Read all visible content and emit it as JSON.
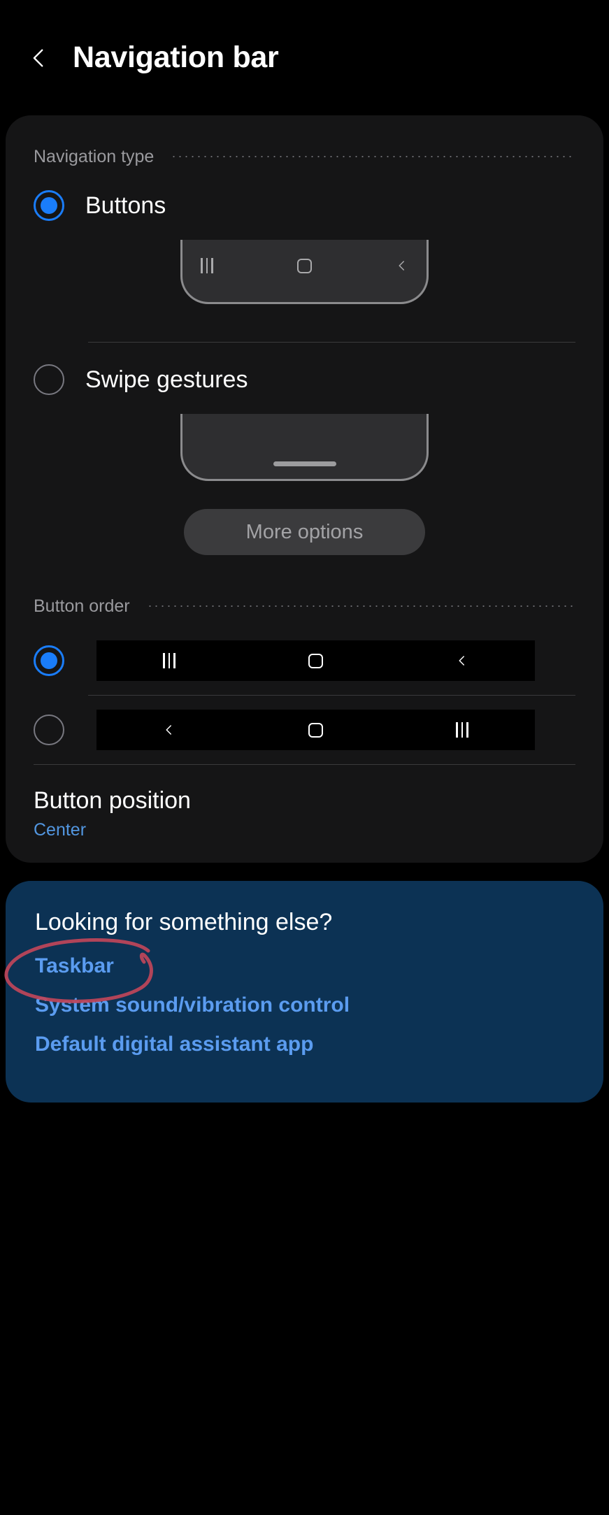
{
  "header": {
    "back_icon": "chevron-left-icon",
    "title": "Navigation bar"
  },
  "navigation_type": {
    "section_label": "Navigation type",
    "options": [
      {
        "label": "Buttons",
        "selected": true,
        "preview_icons": [
          "recents-icon",
          "home-icon",
          "back-icon"
        ]
      },
      {
        "label": "Swipe gestures",
        "selected": false,
        "preview_icons": [
          "gesture-handle-bar"
        ]
      }
    ],
    "more_options_label": "More options"
  },
  "button_order": {
    "section_label": "Button order",
    "options": [
      {
        "selected": true,
        "icons": [
          "recents-icon",
          "home-icon",
          "back-icon"
        ]
      },
      {
        "selected": false,
        "icons": [
          "back-icon",
          "home-icon",
          "recents-icon"
        ]
      }
    ]
  },
  "button_position": {
    "title": "Button position",
    "value": "Center"
  },
  "looking_for": {
    "title": "Looking for something else?",
    "links": [
      "Taskbar",
      "System sound/vibration control",
      "Default digital assistant app"
    ]
  },
  "annotation": {
    "type": "hand-drawn-circle",
    "color": "#c0455a",
    "target": "Taskbar"
  },
  "colors": {
    "accent_blue": "#1a7dfa",
    "link_blue": "#5b9cf0",
    "card_bg": "#151516",
    "links_card_bg": "#0c3254",
    "page_bg": "#000000"
  }
}
